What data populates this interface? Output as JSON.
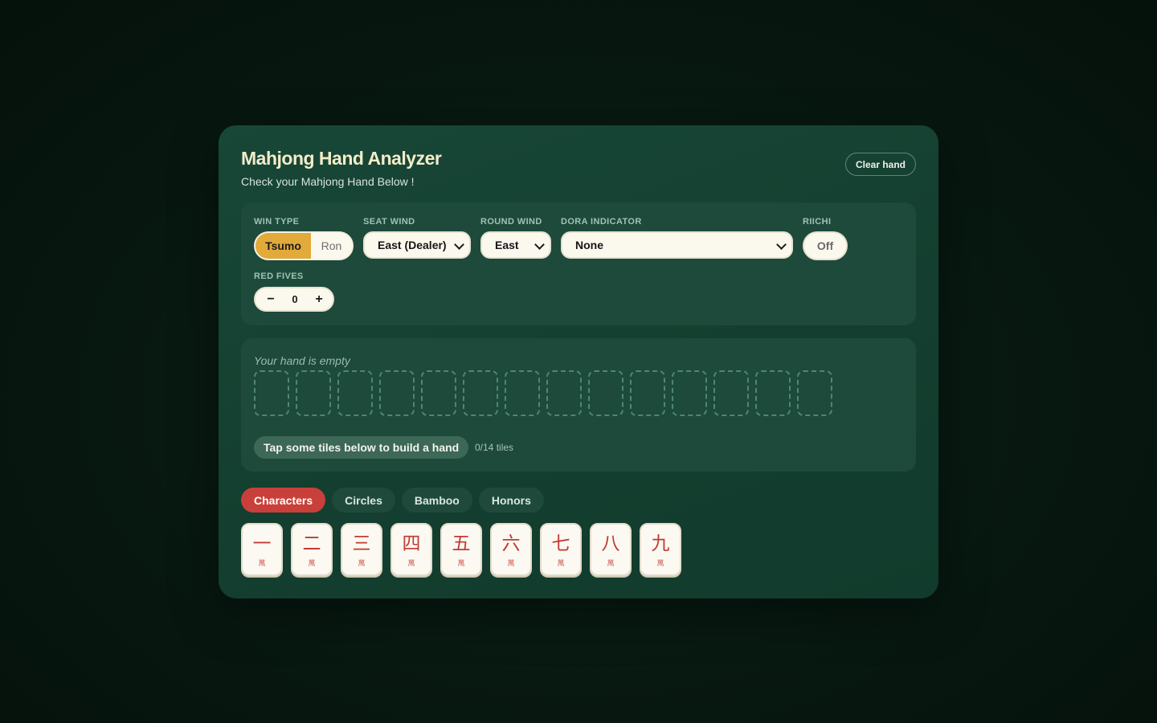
{
  "header": {
    "title": "Mahjong Hand Analyzer",
    "subtitle": "Check your Mahjong Hand Below !",
    "clear_label": "Clear hand"
  },
  "settings": {
    "win_type": {
      "label": "WIN TYPE",
      "options": [
        "Tsumo",
        "Ron"
      ],
      "selected": "Tsumo"
    },
    "seat_wind": {
      "label": "SEAT WIND",
      "value": "East (Dealer)"
    },
    "round_wind": {
      "label": "ROUND WIND",
      "value": "East"
    },
    "dora_indicator": {
      "label": "DORA INDICATOR",
      "value": "None"
    },
    "riichi": {
      "label": "RIICHI",
      "value": "Off"
    },
    "red_fives": {
      "label": "RED FIVES",
      "minus": "−",
      "value": "0",
      "plus": "+"
    }
  },
  "hand": {
    "empty_message": "Your hand is empty",
    "slot_count": 14,
    "hint": "Tap some tiles below to build a hand",
    "count_text": "0/14 tiles"
  },
  "tabs": [
    {
      "label": "Characters",
      "active": true
    },
    {
      "label": "Circles",
      "active": false
    },
    {
      "label": "Bamboo",
      "active": false
    },
    {
      "label": "Honors",
      "active": false
    }
  ],
  "tiles": [
    {
      "numeral": "一",
      "suit": "萬"
    },
    {
      "numeral": "二",
      "suit": "萬"
    },
    {
      "numeral": "三",
      "suit": "萬"
    },
    {
      "numeral": "四",
      "suit": "萬"
    },
    {
      "numeral": "五",
      "suit": "萬"
    },
    {
      "numeral": "六",
      "suit": "萬"
    },
    {
      "numeral": "七",
      "suit": "萬"
    },
    {
      "numeral": "八",
      "suit": "萬"
    },
    {
      "numeral": "九",
      "suit": "萬"
    }
  ],
  "colors": {
    "accent_gold": "#e2a93b",
    "active_tab_red": "#c9403a",
    "tile_red": "#c23a34",
    "panel_green": "#1d4a3b",
    "card_green": "#164434",
    "title_cream": "#f4ecc9"
  }
}
